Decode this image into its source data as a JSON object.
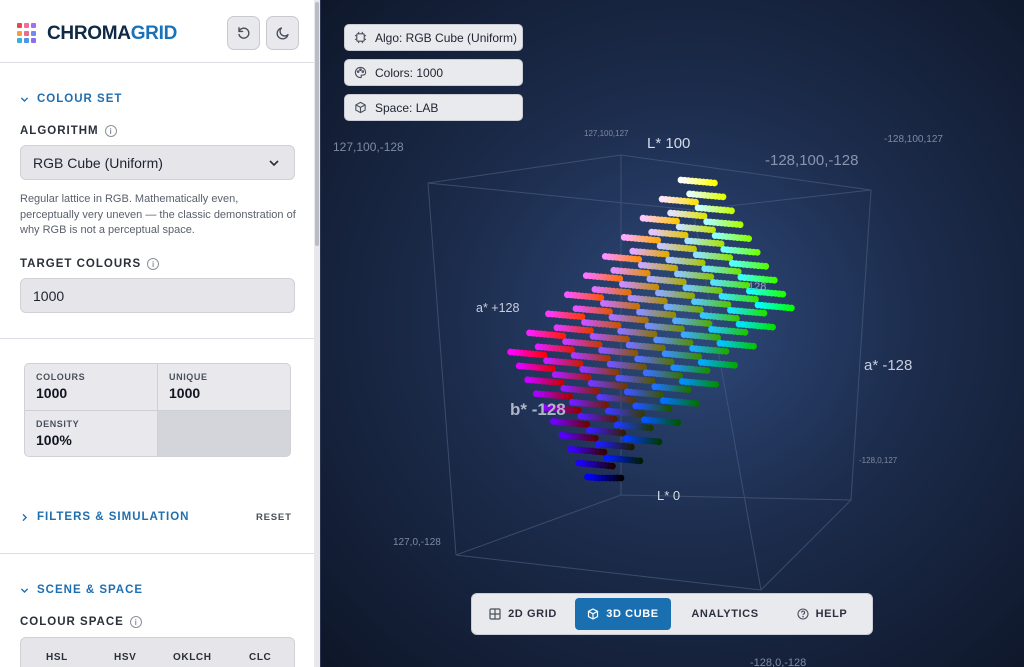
{
  "app": {
    "logo_left": "CHROMA",
    "logo_right": "GRID"
  },
  "header": {
    "buttons": [
      {
        "name": "reset-view-button",
        "icon": "rotate-ccw-icon"
      },
      {
        "name": "theme-toggle-button",
        "icon": "moon-icon"
      }
    ]
  },
  "colour_set": {
    "title": "COLOUR SET",
    "algorithm_label": "ALGORITHM",
    "algorithm_value": "RGB Cube (Uniform)",
    "algorithm_description": "Regular lattice in RGB. Mathematically even, perceptually very uneven — the classic demonstration of why RGB is not a perceptual space.",
    "target_label": "TARGET COLOURS",
    "target_value": "1000"
  },
  "stats": {
    "colours_label": "COLOURS",
    "colours_value": "1000",
    "unique_label": "UNIQUE",
    "unique_value": "1000",
    "density_label": "DENSITY",
    "density_value": "100%"
  },
  "filters": {
    "title": "FILTERS & SIMULATION",
    "reset_label": "RESET"
  },
  "scene_space": {
    "title": "SCENE & SPACE",
    "colour_space_label": "COLOUR SPACE",
    "spaces": [
      "HSL",
      "HSV",
      "OKLCH",
      "CLC"
    ]
  },
  "overlay": {
    "algo_label": "Algo: RGB Cube (Uniform)",
    "colors_label": "Colors: 1000",
    "space_label": "Space: LAB"
  },
  "axis_labels": {
    "l_top": "L* 100",
    "l_bottom": "L* 0",
    "a_pos": "a* +128",
    "a_neg": "a* -128",
    "b_neg": "b* -128",
    "b_pos_partial": "128"
  },
  "corner_labels": {
    "c1": "127,100,-128",
    "c2": "127,100,127",
    "c3": "-128,100,127",
    "c4": "-128,100,-128",
    "c5": "-128,0,127",
    "c6": "127,0,-128",
    "c7": "-128,0,-128"
  },
  "toolbar": {
    "grid_label": "2D GRID",
    "cube_label": "3D CUBE",
    "analytics_label": "ANALYTICS",
    "help_label": "HELP",
    "active": "3D CUBE"
  },
  "colors": {
    "accent": "#1a6fb0",
    "logo_navy": "#0f2a46",
    "viewport_bg": "#1c2c4c"
  }
}
